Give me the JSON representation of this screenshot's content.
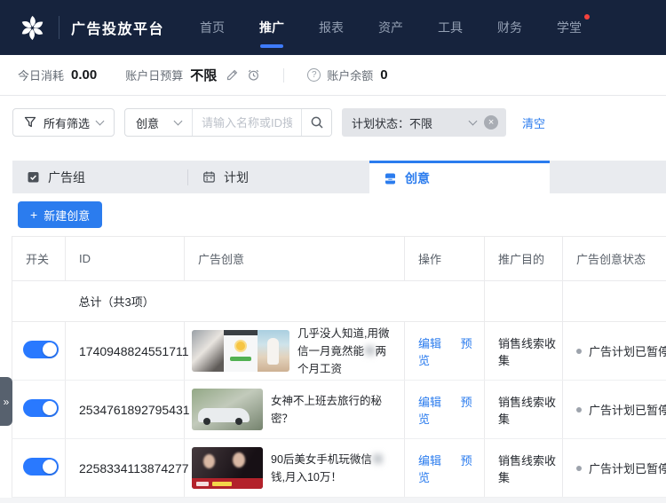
{
  "nav": {
    "brand": "广告投放平台",
    "items": [
      {
        "label": "首页"
      },
      {
        "label": "推广"
      },
      {
        "label": "报表"
      },
      {
        "label": "资产"
      },
      {
        "label": "工具"
      },
      {
        "label": "财务"
      },
      {
        "label": "学堂"
      }
    ]
  },
  "stats": {
    "spend_label": "今日消耗",
    "spend_value": "0.00",
    "budget_label": "账户日预算",
    "budget_value": "不限",
    "balance_label": "账户余额",
    "balance_value": "0"
  },
  "filters": {
    "all_filters_label": "所有筛选",
    "type_select_value": "创意",
    "search_placeholder": "请输入名称或ID搜索",
    "status_tag": "计划状态：不限",
    "clear_label": "清空"
  },
  "tabs": [
    {
      "label": "广告组"
    },
    {
      "label": "计划"
    },
    {
      "label": "创意"
    }
  ],
  "toolbar": {
    "new_creative_label": "新建创意"
  },
  "table": {
    "headers": [
      "开关",
      "ID",
      "广告创意",
      "操作",
      "推广目的",
      "广告创意状态"
    ],
    "total_label": "总计（共3项）",
    "edit_label": "编辑",
    "preview_label": "预览",
    "rows": [
      {
        "id": "1740948824551711",
        "title_pre": "几乎没人知道,用微信一月竟然能",
        "title_blur": "赚",
        "title_post": "两个月工资",
        "objective": "销售线索收集",
        "status": "广告计划已暂停",
        "toggle_on": true
      },
      {
        "id": "2534761892795431",
        "title_pre": "女神不上班去旅行的秘密？",
        "title_blur": "",
        "title_post": "",
        "objective": "销售线索收集",
        "status": "广告计划已暂停",
        "toggle_on": true
      },
      {
        "id": "2258334113874277",
        "title_pre": "90后美女手机玩微信",
        "title_blur": "赚",
        "title_post": "钱,月入10万！",
        "objective": "销售线索收集",
        "status": "广告计划已暂停",
        "toggle_on": true
      }
    ]
  },
  "icons": {
    "plus": "+",
    "close": "×",
    "help": "?",
    "expand": "»"
  },
  "colors": {
    "accent": "#2B7CEE",
    "nav_bg": "#16233D",
    "badge_red": "#F5413D",
    "toggle_on": "#2979FF",
    "tab_bar_bg": "#E9EBEF"
  }
}
